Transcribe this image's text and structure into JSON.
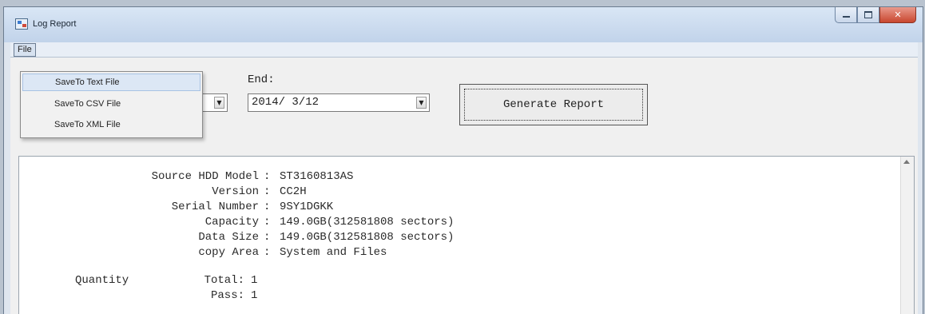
{
  "window": {
    "title": "Log Report"
  },
  "menu": {
    "file_label": "File",
    "items": [
      "SaveTo Text File",
      "SaveTo CSV File",
      "SaveTo XML File"
    ]
  },
  "controls": {
    "end_label": "End:",
    "start_value": "",
    "end_value": "2014/ 3/12",
    "generate_label": "Generate Report"
  },
  "report": {
    "lines": [
      {
        "label": "Source HDD Model",
        "sep": ":",
        "value": "ST3160813AS"
      },
      {
        "label": "Version",
        "sep": ":",
        "value": "CC2H"
      },
      {
        "label": "Serial Number",
        "sep": ":",
        "value": "9SY1DGKK"
      },
      {
        "label": "Capacity",
        "sep": ":",
        "value": "149.0GB(312581808 sectors)"
      },
      {
        "label": "Data Size",
        "sep": ":",
        "value": "149.0GB(312581808 sectors)"
      },
      {
        "label": "copy Area",
        "sep": ":",
        "value": "System and Files"
      }
    ],
    "quantity_label": "Quantity",
    "quantity_lines": [
      {
        "label": "Total:",
        "value": "1"
      },
      {
        "label": "Pass:",
        "value": "1"
      }
    ]
  }
}
